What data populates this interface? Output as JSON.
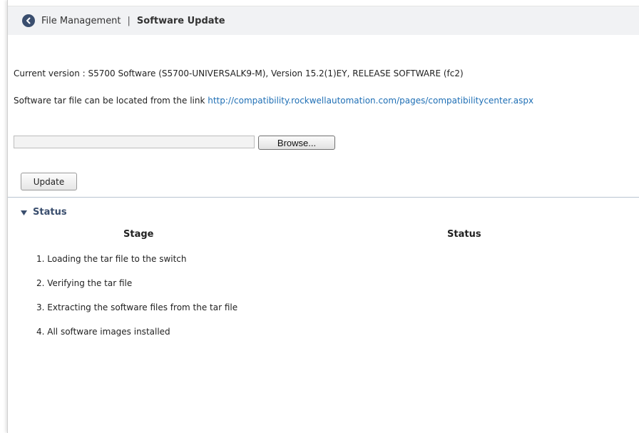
{
  "header": {
    "breadcrumb_parent": "File Management",
    "separator": "|",
    "breadcrumb_current": "Software Update"
  },
  "info": {
    "current_version": "Current version :  S5700 Software (S5700-UNIVERSALK9-M), Version 15.2(1)EY, RELEASE SOFTWARE (fc2)",
    "tar_text": "Software tar file can be located from the link",
    "tar_link": "http://compatibility.rockwellautomation.com/pages/compatibilitycenter.aspx"
  },
  "upload": {
    "file_value": "",
    "browse_label": "Browse...",
    "update_label": "Update"
  },
  "status": {
    "section_label": "Status",
    "col_stage": "Stage",
    "col_status": "Status",
    "stages": [
      {
        "label": "1. Loading the tar file to the switch",
        "status": ""
      },
      {
        "label": "2. Verifying the tar file",
        "status": ""
      },
      {
        "label": "3. Extracting the software files from the tar file",
        "status": ""
      },
      {
        "label": "4. All software images installed",
        "status": ""
      }
    ]
  },
  "colors": {
    "accent": "#3a4e6e",
    "link": "#1f6fb5",
    "header_bg": "#f1f2f4"
  },
  "icons": {
    "back": "back-arrow-icon",
    "expand": "triangle-down-icon"
  }
}
